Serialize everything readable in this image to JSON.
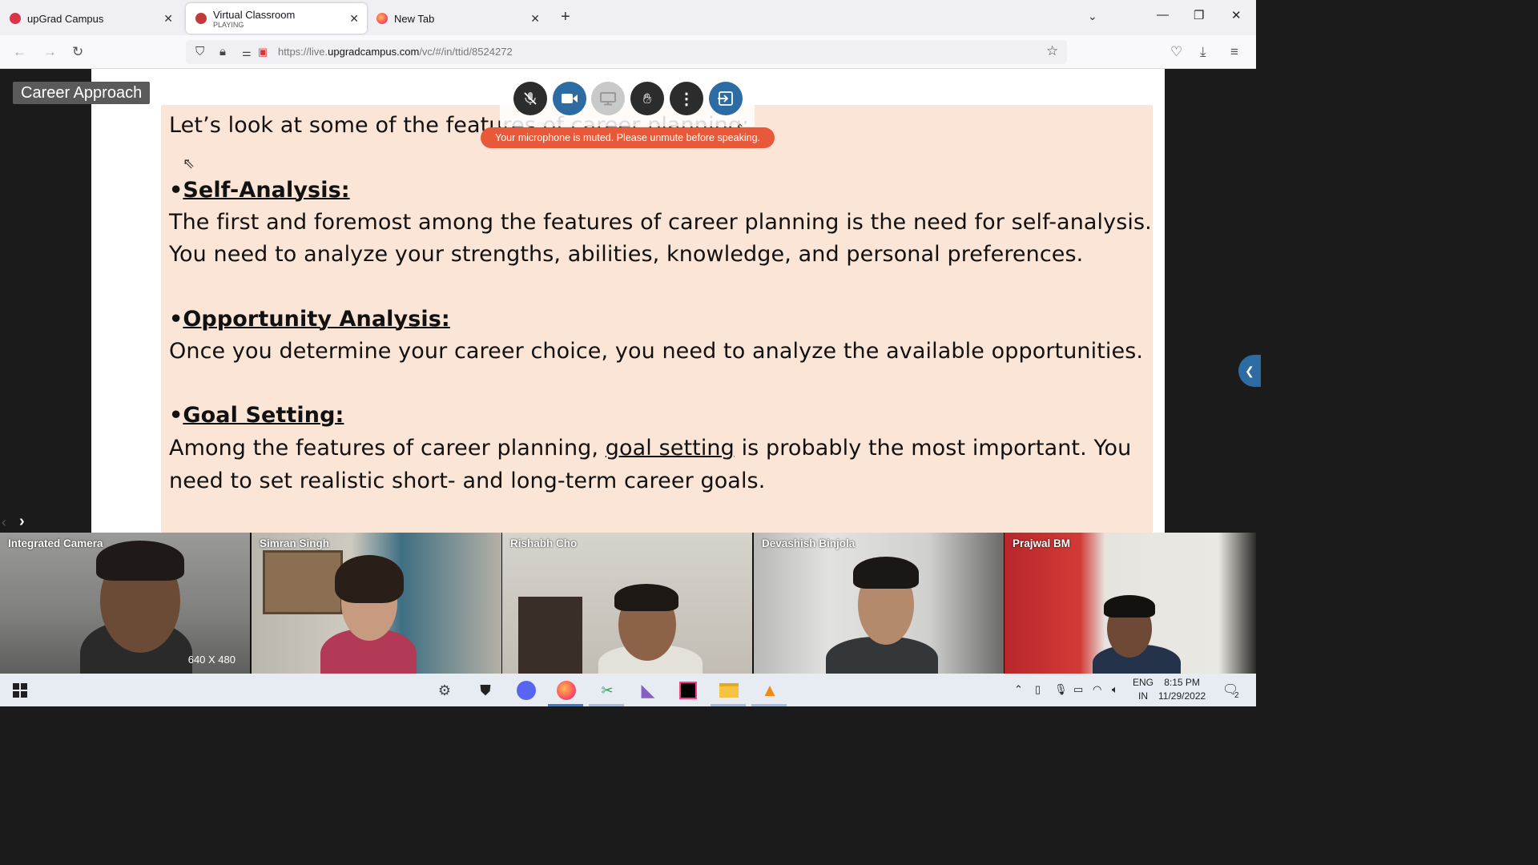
{
  "browser": {
    "tabs": [
      {
        "title": "upGrad Campus",
        "subtitle": ""
      },
      {
        "title": "Virtual Classroom",
        "subtitle": "PLAYING"
      },
      {
        "title": "New Tab",
        "subtitle": ""
      }
    ],
    "url_prefix": "https://live.",
    "url_domain": "upgradcampus.com",
    "url_path": "/vc/#/in/ttid/8524272"
  },
  "classroom": {
    "session_title": "Career Approach",
    "toast": "Your microphone is muted. Please unmute before speaking.",
    "controls": [
      "mic-muted",
      "camera",
      "screen-share",
      "raise-hand",
      "more",
      "leave"
    ]
  },
  "slide": {
    "intro": "Let’s look at some of the features of career planning:",
    "sections": [
      {
        "heading": "Self-Analysis:",
        "lines": [
          "The first and foremost among the features of career planning is the need for self-analysis.",
          "You need to analyze your strengths, abilities, knowledge, and personal preferences."
        ]
      },
      {
        "heading": "Opportunity Analysis:",
        "lines": [
          "Once you determine your career choice, you need to analyze the available opportunities."
        ]
      },
      {
        "heading": "Goal Setting:",
        "line1_before": "Among the features of career planning, ",
        "line1_link": "goal setting",
        "line1_after": " is probably the most important. You",
        "line2": "need to set realistic short- and long-term career goals."
      }
    ]
  },
  "participants": [
    {
      "name": "Integrated Camera",
      "resolution": "640 X 480"
    },
    {
      "name": "Simran Singh"
    },
    {
      "name": "Rishabh Cho"
    },
    {
      "name": "Devashish Binjola"
    },
    {
      "name": "Prajwal BM"
    }
  ],
  "taskbar": {
    "lang_top": "ENG",
    "lang_bottom": "IN",
    "time": "8:15 PM",
    "date": "11/29/2022",
    "notification_count": "2"
  },
  "colors": {
    "accent": "#2d6ca2",
    "toast": "#e8593a",
    "slide_bg": "#fbe5d6"
  }
}
